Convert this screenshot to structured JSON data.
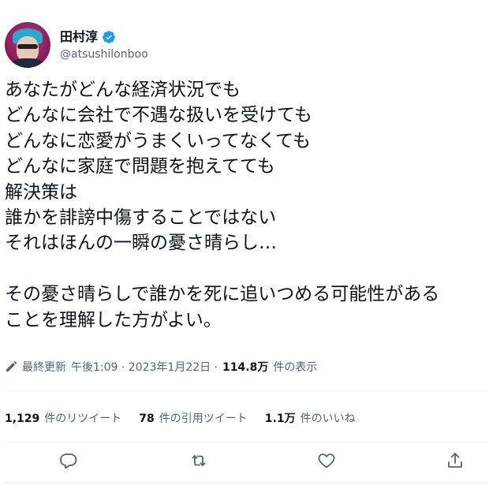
{
  "author": {
    "display_name": "田村淳",
    "handle": "@atsushilonboo"
  },
  "tweet": {
    "lines": [
      "あなたがどんな経済状況でも",
      "どんなに会社で不遇な扱いを受けても",
      "どんなに恋愛がうまくいってなくても",
      "どんなに家庭で問題を抱えてても",
      "解決策は",
      "誰かを誹謗中傷することではない",
      "それはほんの一瞬の憂さ晴らし…",
      "",
      "その憂さ晴らしで誰かを死に追いつめる可能性がある",
      "ことを理解した方がよい。"
    ]
  },
  "meta": {
    "edited_label": "最終更新",
    "timestamp": "午後1:09 · 2023年1月22日 ·",
    "views_count": "114.8万",
    "views_label": "件の表示"
  },
  "stats": {
    "retweets_count": "1,129",
    "retweets_label": "件のリツイート",
    "quotes_count": "78",
    "quotes_label": "件の引用ツイート",
    "likes_count": "1.1万",
    "likes_label": "件のいいね"
  },
  "icons": {
    "verified": "verified-badge-icon",
    "edited": "pencil-icon",
    "reply": "reply-icon",
    "retweet": "retweet-icon",
    "like": "heart-icon",
    "share": "share-icon"
  },
  "colors": {
    "verified": "#1d9bf0",
    "text": "#0f1419",
    "secondary": "#536471",
    "divider": "#eff3f4"
  }
}
